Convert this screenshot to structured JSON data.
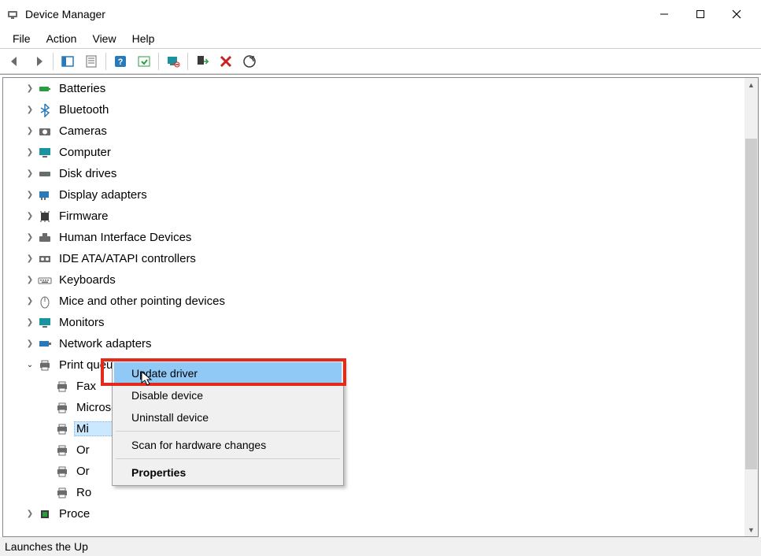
{
  "window": {
    "title": "Device Manager"
  },
  "menu": {
    "file": "File",
    "action": "Action",
    "view": "View",
    "help": "Help"
  },
  "toolbar": {
    "back_icon": "back-arrow-icon",
    "forward_icon": "forward-arrow-icon",
    "show_hide_icon": "show-hide-tree-icon",
    "properties_icon": "properties-sheet-icon",
    "help_icon": "help-icon",
    "update_icon": "update-driver-icon",
    "monitor_icon": "uninstall-device-icon",
    "enable_icon": "enable-device-icon",
    "delete_icon": "delete-icon",
    "scan_icon": "scan-hardware-icon"
  },
  "tree": {
    "items": [
      {
        "label": "Batteries",
        "expandable": true
      },
      {
        "label": "Bluetooth",
        "expandable": true
      },
      {
        "label": "Cameras",
        "expandable": true
      },
      {
        "label": "Computer",
        "expandable": true
      },
      {
        "label": "Disk drives",
        "expandable": true
      },
      {
        "label": "Display adapters",
        "expandable": true
      },
      {
        "label": "Firmware",
        "expandable": true
      },
      {
        "label": "Human Interface Devices",
        "expandable": true
      },
      {
        "label": "IDE ATA/ATAPI controllers",
        "expandable": true
      },
      {
        "label": "Keyboards",
        "expandable": true
      },
      {
        "label": "Mice and other pointing devices",
        "expandable": true
      },
      {
        "label": "Monitors",
        "expandable": true
      },
      {
        "label": "Network adapters",
        "expandable": true
      }
    ],
    "print_queues": {
      "label": "Print queues",
      "expanded": true,
      "children": [
        {
          "label": "Fax"
        },
        {
          "label": "Microsoft Print to PDF"
        },
        {
          "label": "Mi",
          "truncated": true,
          "selected": true
        },
        {
          "label": "Or",
          "truncated": true
        },
        {
          "label": "Or",
          "truncated": true
        },
        {
          "label": "Ro",
          "truncated": true
        }
      ]
    },
    "processors": {
      "label": "Proce",
      "truncated": true,
      "expandable": true
    }
  },
  "context_menu": {
    "update": "Update driver",
    "disable": "Disable device",
    "uninstall": "Uninstall device",
    "scan": "Scan for hardware changes",
    "properties": "Properties"
  },
  "statusbar": {
    "text": "Launches the Up"
  }
}
